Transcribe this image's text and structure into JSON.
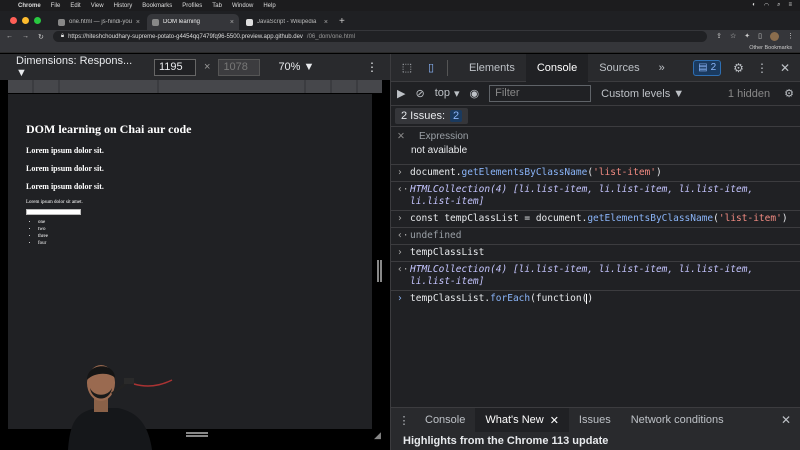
{
  "menubar": {
    "items": [
      "Chrome",
      "File",
      "Edit",
      "View",
      "History",
      "Bookmarks",
      "Profiles",
      "Tab",
      "Window",
      "Help"
    ]
  },
  "tabs": [
    {
      "title": "one.html — js-hindi-youtube [..."
    },
    {
      "title": "DOM learning"
    },
    {
      "title": "JavaScript - Wikipedia"
    }
  ],
  "omnibox": {
    "url_host": "https://hiteshchoudhary-supreme-potato-g4454qq7479fq96-5500.preview.app.github.dev",
    "url_path": "/06_dom/one.html"
  },
  "bookmarks": {
    "other": "Other Bookmarks"
  },
  "device_toolbar": {
    "dimensions": "Dimensions: Respons... ▼",
    "width": "1195",
    "times": "×",
    "height": "1078",
    "zoom": "70% ▼"
  },
  "page": {
    "h1": "DOM learning on Chai aur code",
    "h2": [
      "Lorem ipsum dolor sit.",
      "Lorem ipsum dolor sit.",
      "Lorem ipsum dolor sit."
    ],
    "para": "Lorem ipsum dolor sit amet.",
    "list": [
      "one",
      "two",
      "three",
      "four"
    ]
  },
  "devtools": {
    "tabs": [
      "Elements",
      "Console",
      "Sources"
    ],
    "more": "»",
    "issues_count": "2",
    "console_toolbar": {
      "context": "top",
      "filter_placeholder": "Filter",
      "levels": "Custom levels ▼",
      "hidden": "1 hidden"
    },
    "issues_bar": {
      "label": "2 Issues:",
      "count": "2"
    },
    "expression": {
      "label": "Expression",
      "value": "not available"
    },
    "console": {
      "l1_pre": "document.",
      "l1_fn": "getElementsByClassName",
      "l1_open": "(",
      "l1_str": "'list-item'",
      "l1_close": ")",
      "l2": "HTMLCollection(4) [li.list-item, li.list-item, li.list-item, li.list-item]",
      "l3_pre": "const tempClassList = document.",
      "l3_fn": "getElementsByClassName",
      "l3_open": "(",
      "l3_str": "'list-item'",
      "l3_close": ")",
      "l4": "undefined",
      "l5": "tempClassList",
      "l6": "HTMLCollection(4) [li.list-item, li.list-item, li.list-item, li.list-item]",
      "input_pre": "tempClassList.",
      "input_fn": "forEach",
      "input_mid": "(function(",
      "input_end": ")"
    },
    "drawer": {
      "tabs": [
        "Console",
        "What's New",
        "Issues",
        "Network conditions"
      ],
      "message": "Highlights from the Chrome 113 update"
    }
  }
}
